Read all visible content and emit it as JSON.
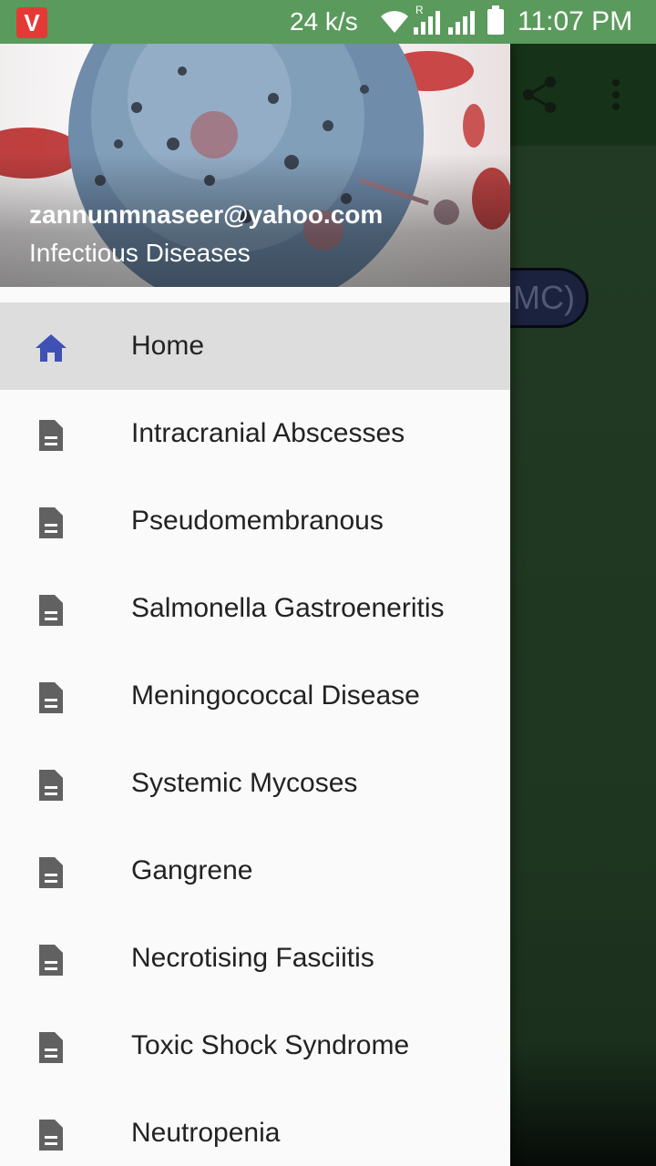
{
  "status_bar": {
    "app_icon_letter": "V",
    "network_speed": "24 k/s",
    "roaming_indicator": "R",
    "time": "11:07 PM"
  },
  "background_app": {
    "pill_text": "MC)"
  },
  "drawer": {
    "header": {
      "email": "zannunmnaseer@yahoo.com",
      "subtitle": "Infectious Diseases"
    },
    "items": [
      {
        "label": "Home",
        "icon": "home-icon",
        "active": true
      },
      {
        "label": "Intracranial Abscesses",
        "icon": "document-icon"
      },
      {
        "label": "Pseudomembranous",
        "icon": "document-icon"
      },
      {
        "label": "Salmonella Gastroeneritis",
        "icon": "document-icon"
      },
      {
        "label": "Meningococcal Disease",
        "icon": "document-icon"
      },
      {
        "label": "Systemic Mycoses",
        "icon": "document-icon"
      },
      {
        "label": "Gangrene",
        "icon": "document-icon"
      },
      {
        "label": "Necrotising Fasciitis",
        "icon": "document-icon"
      },
      {
        "label": "Toxic Shock Syndrome",
        "icon": "document-icon"
      },
      {
        "label": "Neutropenia",
        "icon": "document-icon"
      }
    ]
  },
  "colors": {
    "status_bar": "#5a9a5c",
    "active_item": "#dddddd",
    "home_icon": "#3f51b5",
    "doc_icon": "#616161"
  }
}
